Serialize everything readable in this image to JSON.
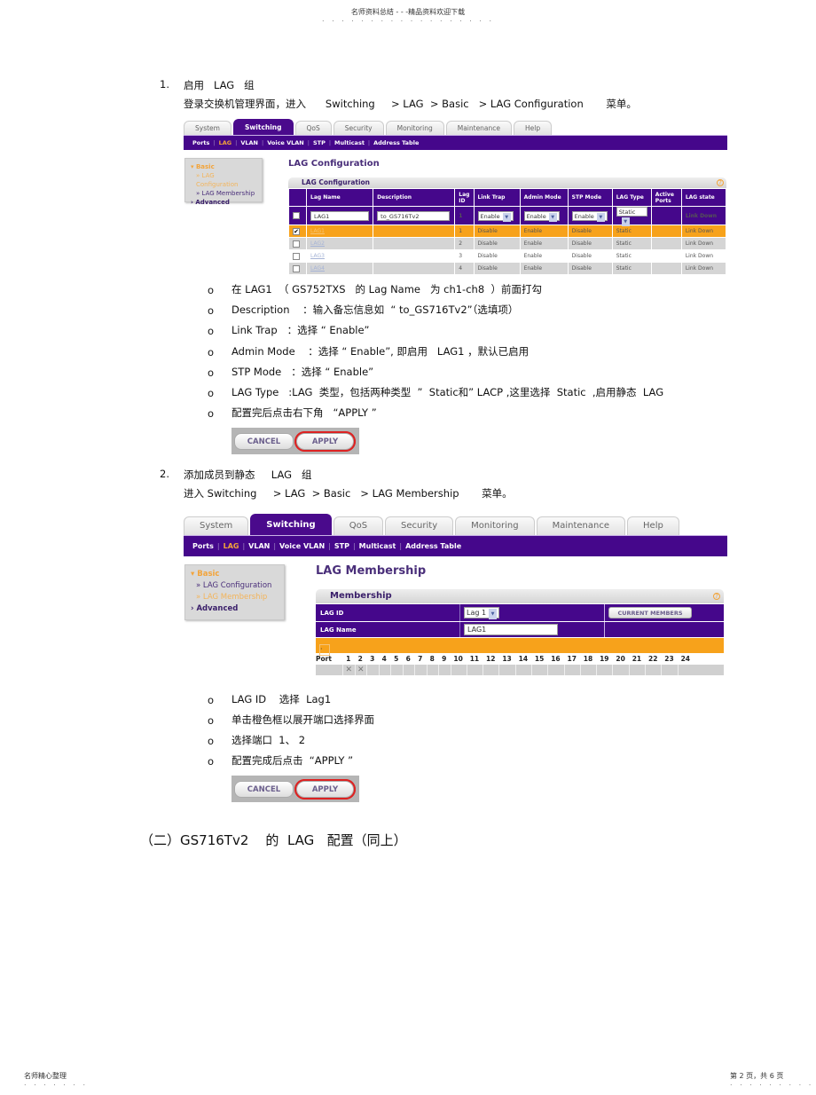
{
  "page_header": {
    "text": "名师资料总结 - - -精品资料欢迎下载"
  },
  "page_footer": {
    "left": "名师精心整理",
    "right": "第 2 页，共 6 页"
  },
  "step1": {
    "number": "1.",
    "title": "启用   LAG   组",
    "instruction": "登录交换机管理界面，进入      Switching     > LAG  > Basic   > LAG Configuration       菜单。"
  },
  "ui1": {
    "tabs": [
      "System",
      "Switching",
      "QoS",
      "Security",
      "Monitoring",
      "Maintenance",
      "Help"
    ],
    "active_tab": "Switching",
    "subnav": [
      "Ports",
      "LAG",
      "VLAN",
      "Voice VLAN",
      "STP",
      "Multicast",
      "Address Table"
    ],
    "subnav_active": "LAG",
    "sidebar": {
      "basic": "Basic",
      "items": [
        "» LAG Configuration",
        "» LAG Membership"
      ],
      "active_item": "» LAG Configuration",
      "advanced": "Advanced"
    },
    "page_title": "LAG Configuration",
    "panel_title": "LAG Configuration",
    "columns": [
      "",
      "Lag Name",
      "Description",
      "Lag ID",
      "Link Trap",
      "Admin Mode",
      "STP Mode",
      "LAG Type",
      "Active Ports",
      "LAG state"
    ],
    "edit_row": {
      "lag_name": "LAG1",
      "description": "to_GS716Tv2",
      "lag_id": "1",
      "link_trap": "Enable",
      "admin_mode": "Enable",
      "stp_mode": "Enable",
      "lag_type": "Static",
      "active_ports": "",
      "lag_state": "Link Down"
    },
    "rows": [
      {
        "checked": true,
        "lag_name": "LAG1",
        "description": "",
        "lag_id": "1",
        "link_trap": "Disable",
        "admin_mode": "Enable",
        "stp_mode": "Disable",
        "lag_type": "Static",
        "active_ports": "",
        "lag_state": "Link Down"
      },
      {
        "checked": false,
        "lag_name": "LAG2",
        "description": "",
        "lag_id": "2",
        "link_trap": "Disable",
        "admin_mode": "Enable",
        "stp_mode": "Disable",
        "lag_type": "Static",
        "active_ports": "",
        "lag_state": "Link Down"
      },
      {
        "checked": false,
        "lag_name": "LAG3",
        "description": "",
        "lag_id": "3",
        "link_trap": "Disable",
        "admin_mode": "Enable",
        "stp_mode": "Disable",
        "lag_type": "Static",
        "active_ports": "",
        "lag_state": "Link Down"
      },
      {
        "checked": false,
        "lag_name": "LAG4",
        "description": "",
        "lag_id": "4",
        "link_trap": "Disable",
        "admin_mode": "Enable",
        "stp_mode": "Disable",
        "lag_type": "Static",
        "active_ports": "",
        "lag_state": "Link Down"
      }
    ]
  },
  "step1_bullets": [
    "在 LAG1  （ GS752TXS   的 Lag Name   为 ch1-ch8  ）前面打勾",
    "Description    ：输入备忘信息如  “ to_GS716Tv2”（选填项）",
    "Link Trap   ：选择 “ Enable”",
    "Admin Mode    ：选择 “ Enable”, 即启用   LAG1 ，默认已启用",
    "STP Mode   ：选择 “ Enable”",
    "LAG Type   :LAG  类型，包括两种类型  ”  Static和” LACP ,这里选择  Static  ,启用静态  LAG",
    "配置完后点击右下角   “APPLY ”"
  ],
  "bullet_marker": "o",
  "buttons": {
    "cancel": "CANCEL",
    "apply": "APPLY"
  },
  "step2": {
    "number": "2.",
    "title": "添加成员到静态     LAG   组",
    "instruction": "进入 Switching     > LAG  > Basic   > LAG Membership       菜单。"
  },
  "ui2": {
    "tabs": [
      "System",
      "Switching",
      "QoS",
      "Security",
      "Monitoring",
      "Maintenance",
      "Help"
    ],
    "active_tab": "Switching",
    "subnav": [
      "Ports",
      "LAG",
      "VLAN",
      "Voice VLAN",
      "STP",
      "Multicast",
      "Address Table"
    ],
    "subnav_active": "LAG",
    "sidebar": {
      "basic": "Basic",
      "items": [
        "» LAG Configuration",
        "» LAG Membership"
      ],
      "active_item": "» LAG Membership",
      "advanced": "Advanced"
    },
    "page_title": "LAG Membership",
    "panel_title": "Membership",
    "lag_id_label": "LAG ID",
    "lag_id_value": "Lag 1",
    "lag_name_label": "LAG Name",
    "lag_name_value": "LAG1",
    "current_members_button": "CURRENT MEMBERS",
    "port_label": "Port",
    "ports": [
      "1",
      "2",
      "3",
      "4",
      "5",
      "6",
      "7",
      "8",
      "9",
      "10",
      "11",
      "12",
      "13",
      "14",
      "15",
      "16",
      "17",
      "18",
      "19",
      "20",
      "21",
      "22",
      "23",
      "24"
    ],
    "selected_ports": [
      "1",
      "2"
    ]
  },
  "step2_bullets": [
    "LAG ID    选择  Lag1",
    "单击橙色框以展开端口选择界面",
    "选择端口  1、 2",
    "配置完成后点击  “APPLY ”"
  ],
  "section2_heading": "（二）GS716Tv2    的  LAG   配置（同上）"
}
